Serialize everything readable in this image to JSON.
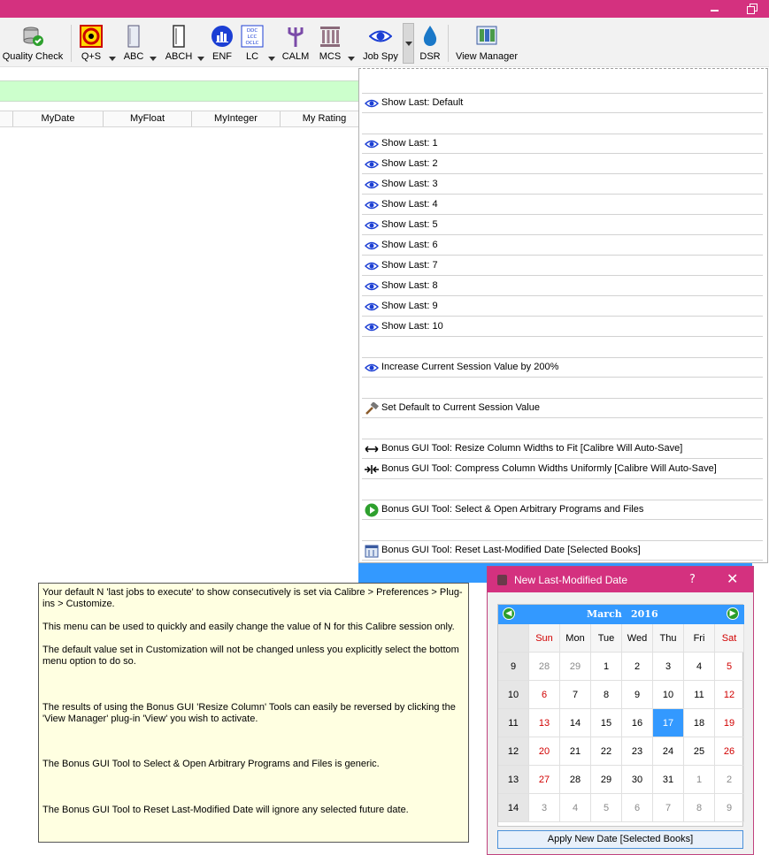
{
  "toolbar": {
    "items": [
      {
        "label": "Quality Check",
        "icon": "database-check-icon"
      },
      {
        "label": "Q+S",
        "icon": "biohazard-icon"
      },
      {
        "label": "ABC",
        "icon": "book-spine-icon"
      },
      {
        "label": "ABCH",
        "icon": "book-spine-outline-icon"
      },
      {
        "label": "ENF",
        "icon": "bar-chart-circle-icon"
      },
      {
        "label": "LC",
        "icon": "ddc-lcc-oclc-card-icon"
      },
      {
        "label": "CALM",
        "icon": "trident-icon"
      },
      {
        "label": "MCS",
        "icon": "columns-temple-icon"
      },
      {
        "label": "Job Spy",
        "icon": "eye-icon"
      },
      {
        "label": "DSR",
        "icon": "water-drop-icon"
      },
      {
        "label": "View Manager",
        "icon": "view-manager-icon"
      }
    ],
    "lc_icon_lines": [
      "DDC",
      "LCC",
      "OCLC"
    ]
  },
  "columns": [
    "MyDate",
    "MyFloat",
    "MyInteger",
    "My Rating"
  ],
  "menu": {
    "show_last_default": "Show Last: Default",
    "show_last_items": [
      "Show Last:  1",
      "Show Last:  2",
      "Show Last:  3",
      "Show Last:  4",
      "Show Last:  5",
      "Show Last:  6",
      "Show Last:  7",
      "Show Last:  8",
      "Show Last:  9",
      "Show Last:  10"
    ],
    "increase": "Increase Current Session Value by 200%",
    "set_default": "Set Default to Current Session Value",
    "resize": "Bonus GUI Tool: Resize Column Widths to Fit [Calibre Will Auto-Save]",
    "compress": "Bonus GUI Tool: Compress Column Widths Uniformly [Calibre Will Auto-Save]",
    "open_programs": "Bonus GUI Tool: Select & Open Arbitrary Programs and Files",
    "reset_date": "Bonus GUI Tool: Reset Last-Modified Date [Selected Books]"
  },
  "tooltip": {
    "p1": "Your default N 'last jobs to execute' to show consecutively is set via Calibre > Preferences > Plug-ins > Customize.",
    "p2": "This menu can be used to quickly and easily change the value of N for this Calibre session only.",
    "p3": "The default value set in Customization will not be changed unless you explicitly select the bottom menu option to do so.",
    "p4": "The results of using the Bonus GUI 'Resize Column' Tools can easily be reversed by clicking the 'View Manager' plug-in 'View' you wish to activate.",
    "p5": "The Bonus GUI Tool to Select & Open Arbitrary Programs and Files is generic.",
    "p6": "The Bonus GUI Tool to Reset Last-Modified Date will ignore any selected future date."
  },
  "dialog": {
    "title": "New Last-Modified Date",
    "help": "?",
    "close": "✕",
    "month": "March",
    "year": "2016",
    "prev": "◀",
    "next": "▶",
    "weekdays": [
      "Sun",
      "Mon",
      "Tue",
      "Wed",
      "Thu",
      "Fri",
      "Sat"
    ],
    "weeks": [
      {
        "wk": "9",
        "days": [
          "28",
          "29",
          "1",
          "2",
          "3",
          "4",
          "5"
        ]
      },
      {
        "wk": "10",
        "days": [
          "6",
          "7",
          "8",
          "9",
          "10",
          "11",
          "12"
        ]
      },
      {
        "wk": "11",
        "days": [
          "13",
          "14",
          "15",
          "16",
          "17",
          "18",
          "19"
        ]
      },
      {
        "wk": "12",
        "days": [
          "20",
          "21",
          "22",
          "23",
          "24",
          "25",
          "26"
        ]
      },
      {
        "wk": "13",
        "days": [
          "27",
          "28",
          "29",
          "30",
          "31",
          "1",
          "2"
        ]
      },
      {
        "wk": "14",
        "days": [
          "3",
          "4",
          "5",
          "6",
          "7",
          "8",
          "9"
        ]
      }
    ],
    "selected": "17",
    "apply_label": "Apply New Date [Selected Books]"
  },
  "colors": {
    "title_bar": "#d4317f",
    "selection": "#3399ff",
    "green_bar": "#ccffcc",
    "tooltip_bg": "#ffffe1",
    "weekend": "#d10000"
  }
}
